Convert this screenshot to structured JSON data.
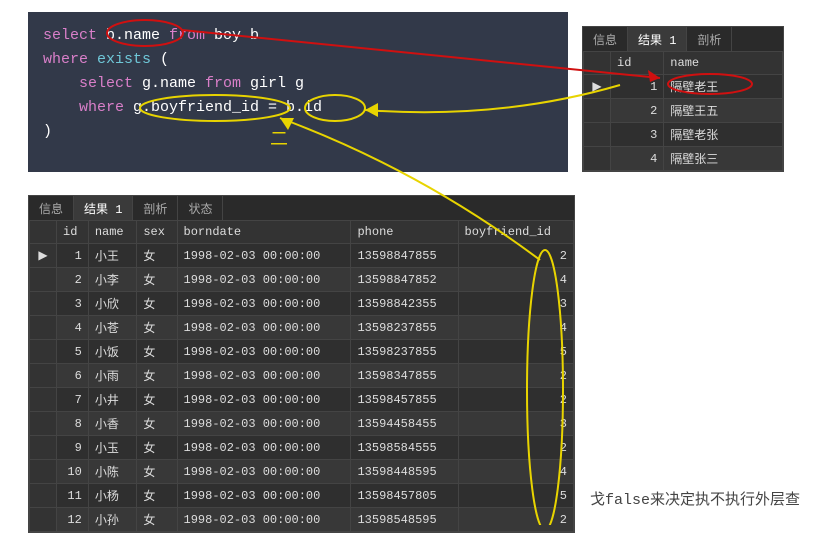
{
  "sql": {
    "line1": {
      "kw1": "select",
      "t1": " b.name ",
      "kw2": "from",
      "t2": " boy b"
    },
    "line2": {
      "kw1": "where",
      "fn1": " exists",
      "t1": " ("
    },
    "line3": {
      "kw1": "select",
      "t1": " g.name ",
      "kw2": "from",
      "t2": " girl g"
    },
    "line4": {
      "kw1": "where",
      "t1": " g.boyfriend_id = b.id"
    },
    "line5": {
      "t1": ")"
    }
  },
  "tabs_top": {
    "t1": "信息",
    "t2": "结果 1",
    "t3": "剖析"
  },
  "tabs_bottom": {
    "t1": "信息",
    "t2": "结果 1",
    "t3": "剖析",
    "t4": "状态"
  },
  "result1": {
    "cols": {
      "c1": "id",
      "c2": "name"
    },
    "r1": {
      "id": "1",
      "name": "隔壁老王"
    },
    "r2": {
      "id": "2",
      "name": "隔壁王五"
    },
    "r3": {
      "id": "3",
      "name": "隔壁老张"
    },
    "r4": {
      "id": "4",
      "name": "隔壁张三"
    }
  },
  "result2": {
    "cols": {
      "c1": "id",
      "c2": "name",
      "c3": "sex",
      "c4": "borndate",
      "c5": "phone",
      "c6": "boyfriend_id"
    },
    "r1": {
      "id": "1",
      "name": "小王",
      "sex": "女",
      "borndate": "1998-02-03 00:00:00",
      "phone": "13598847855",
      "bf": "2"
    },
    "r2": {
      "id": "2",
      "name": "小李",
      "sex": "女",
      "borndate": "1998-02-03 00:00:00",
      "phone": "13598847852",
      "bf": "4"
    },
    "r3": {
      "id": "3",
      "name": "小欣",
      "sex": "女",
      "borndate": "1998-02-03 00:00:00",
      "phone": "13598842355",
      "bf": "3"
    },
    "r4": {
      "id": "4",
      "name": "小苍",
      "sex": "女",
      "borndate": "1998-02-03 00:00:00",
      "phone": "13598237855",
      "bf": "4"
    },
    "r5": {
      "id": "5",
      "name": "小饭",
      "sex": "女",
      "borndate": "1998-02-03 00:00:00",
      "phone": "13598237855",
      "bf": "5"
    },
    "r6": {
      "id": "6",
      "name": "小雨",
      "sex": "女",
      "borndate": "1998-02-03 00:00:00",
      "phone": "13598347855",
      "bf": "2"
    },
    "r7": {
      "id": "7",
      "name": "小井",
      "sex": "女",
      "borndate": "1998-02-03 00:00:00",
      "phone": "13598457855",
      "bf": "2"
    },
    "r8": {
      "id": "8",
      "name": "小香",
      "sex": "女",
      "borndate": "1998-02-03 00:00:00",
      "phone": "13594458455",
      "bf": "3"
    },
    "r9": {
      "id": "9",
      "name": "小玉",
      "sex": "女",
      "borndate": "1998-02-03 00:00:00",
      "phone": "13598584555",
      "bf": "2"
    },
    "r10": {
      "id": "10",
      "name": "小陈",
      "sex": "女",
      "borndate": "1998-02-03 00:00:00",
      "phone": "13598448595",
      "bf": "4"
    },
    "r11": {
      "id": "11",
      "name": "小杨",
      "sex": "女",
      "borndate": "1998-02-03 00:00:00",
      "phone": "13598457805",
      "bf": "5"
    },
    "r12": {
      "id": "12",
      "name": "小孙",
      "sex": "女",
      "borndate": "1998-02-03 00:00:00",
      "phone": "13598548595",
      "bf": "2"
    }
  },
  "annotation": {
    "text": "戈false来决定执不执行外层查",
    "marker": "▶"
  }
}
